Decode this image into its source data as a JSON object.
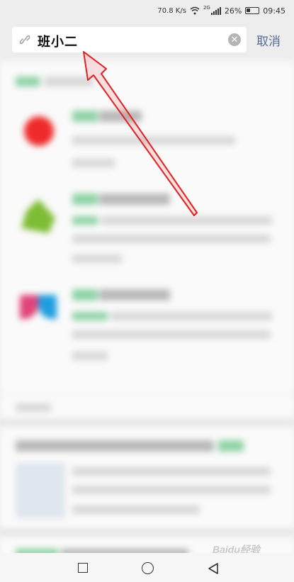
{
  "status_bar": {
    "speed": "70.8 K/s",
    "network": "2G",
    "battery": "26%",
    "time": "09:45"
  },
  "search": {
    "query": "班小二",
    "cancel_label": "取消",
    "clear_icon": "clear-icon",
    "link_icon": "link-icon"
  },
  "watermark": "Baidu经验",
  "nav": {
    "recent_icon": "square-icon",
    "home_icon": "circle-icon",
    "back_icon": "triangle-back-icon"
  },
  "colors": {
    "accent": "#576b95",
    "arrow": "#e02020",
    "background": "#ededed"
  }
}
